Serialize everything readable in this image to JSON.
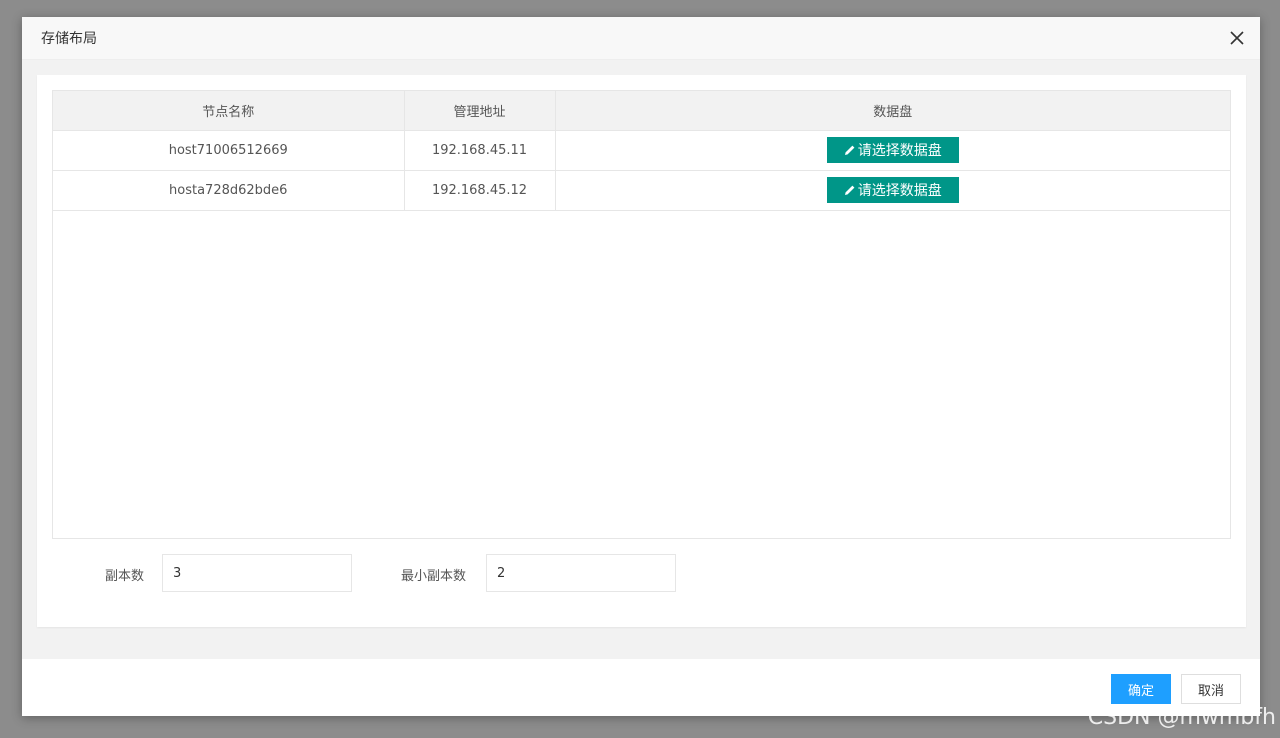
{
  "dialog": {
    "title": "存储布局",
    "close_icon": "close-icon"
  },
  "table": {
    "headers": [
      "节点名称",
      "管理地址",
      "数据盘"
    ],
    "rows": [
      {
        "node_name": "host71006512669",
        "mgmt_address": "192.168.45.11",
        "disk_button_label": "请选择数据盘"
      },
      {
        "node_name": "hosta728d62bde6",
        "mgmt_address": "192.168.45.12",
        "disk_button_label": "请选择数据盘"
      }
    ]
  },
  "form": {
    "replicas_label": "副本数",
    "replicas_value": "3",
    "min_replicas_label": "最小副本数",
    "min_replicas_value": "2"
  },
  "footer": {
    "ok_label": "确定",
    "cancel_label": "取消"
  },
  "watermark": "CSDN @mwmbfh",
  "colors": {
    "disk_button": "#009688",
    "ok_button": "#1e9fff"
  }
}
